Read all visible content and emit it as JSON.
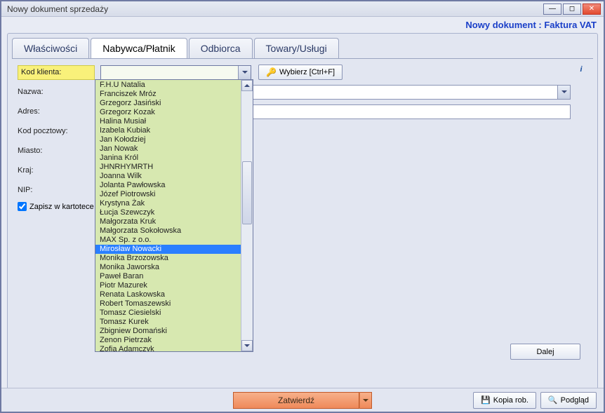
{
  "window": {
    "title": "Nowy dokument sprzedaży"
  },
  "header": {
    "doc_type": "Nowy dokument : Faktura VAT"
  },
  "tabs": {
    "0": {
      "label": "Właściwości"
    },
    "1": {
      "label": "Nabywca/Płatnik"
    },
    "2": {
      "label": "Odbiorca"
    },
    "3": {
      "label": "Towary/Usługi"
    }
  },
  "form": {
    "kod_klienta_label": "Kod klienta:",
    "nazwa_label": "Nazwa:",
    "adres_label": "Adres:",
    "kod_pocztowy_label": "Kod pocztowy:",
    "miasto_label": "Miasto:",
    "kraj_label": "Kraj:",
    "nip_label": "NIP:",
    "zapisz_label": "Zapisz w kartotece klientów",
    "wybierz_label": "Wybierz [Ctrl+F]"
  },
  "clients": [
    "F.H.U Natalia",
    "Franciszek Mróz",
    "Grzegorz Jasiński",
    "Grzegorz Kozak",
    "Halina Musiał",
    "Izabela Kubiak",
    "Jan Kołodziej",
    "Jan Nowak",
    "Janina Król",
    "JHNRHYMRTH",
    "Joanna Wilk",
    "Jolanta Pawłowska",
    "Józef Piotrowski",
    "Krystyna Żak",
    "Łucja Szewczyk",
    "Małgorzata Kruk",
    "Małgorzata Sokołowska",
    "MAX Sp. z o.o.",
    "Mirosław Nowacki",
    "Monika Brzozowska",
    "Monika Jaworska",
    "Paweł Baran",
    "Piotr Mazurek",
    "Renata Laskowska",
    "Robert Tomaszewski",
    "Tomasz Ciesielski",
    "Tomasz Kurek",
    "Zbigniew Domański",
    "Zenon Pietrzak",
    "Zofia Adamczyk"
  ],
  "selected_client_index": 18,
  "buttons": {
    "dalej": "Dalej",
    "zatwierdz": "Zatwierdź",
    "kopia_rob": "Kopia rob.",
    "podglad": "Podgląd"
  }
}
